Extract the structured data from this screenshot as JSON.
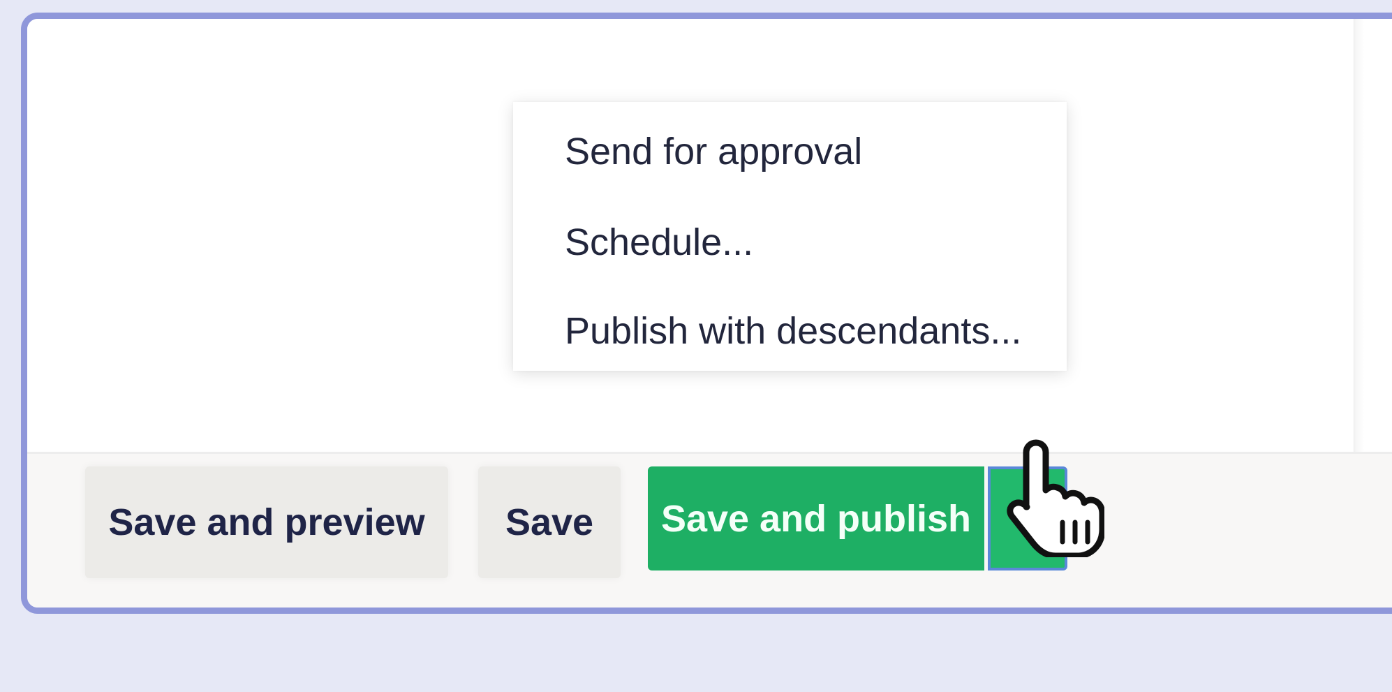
{
  "footer": {
    "save_preview_label": "Save and preview",
    "save_label": "Save",
    "save_publish_label": "Save and publish"
  },
  "dropdown": {
    "items": [
      {
        "label": "Send for approval"
      },
      {
        "label": "Schedule..."
      },
      {
        "label": "Publish with descendants..."
      }
    ]
  },
  "icons": {
    "toggle": "caret-up-icon",
    "cursor": "hand-pointer-icon"
  },
  "colors": {
    "background": "#e6e8f6",
    "frame_border": "#8f97da",
    "publish_green": "#1eaf64",
    "secondary_button": "#ecebe8",
    "text_dark": "#1f2447"
  }
}
